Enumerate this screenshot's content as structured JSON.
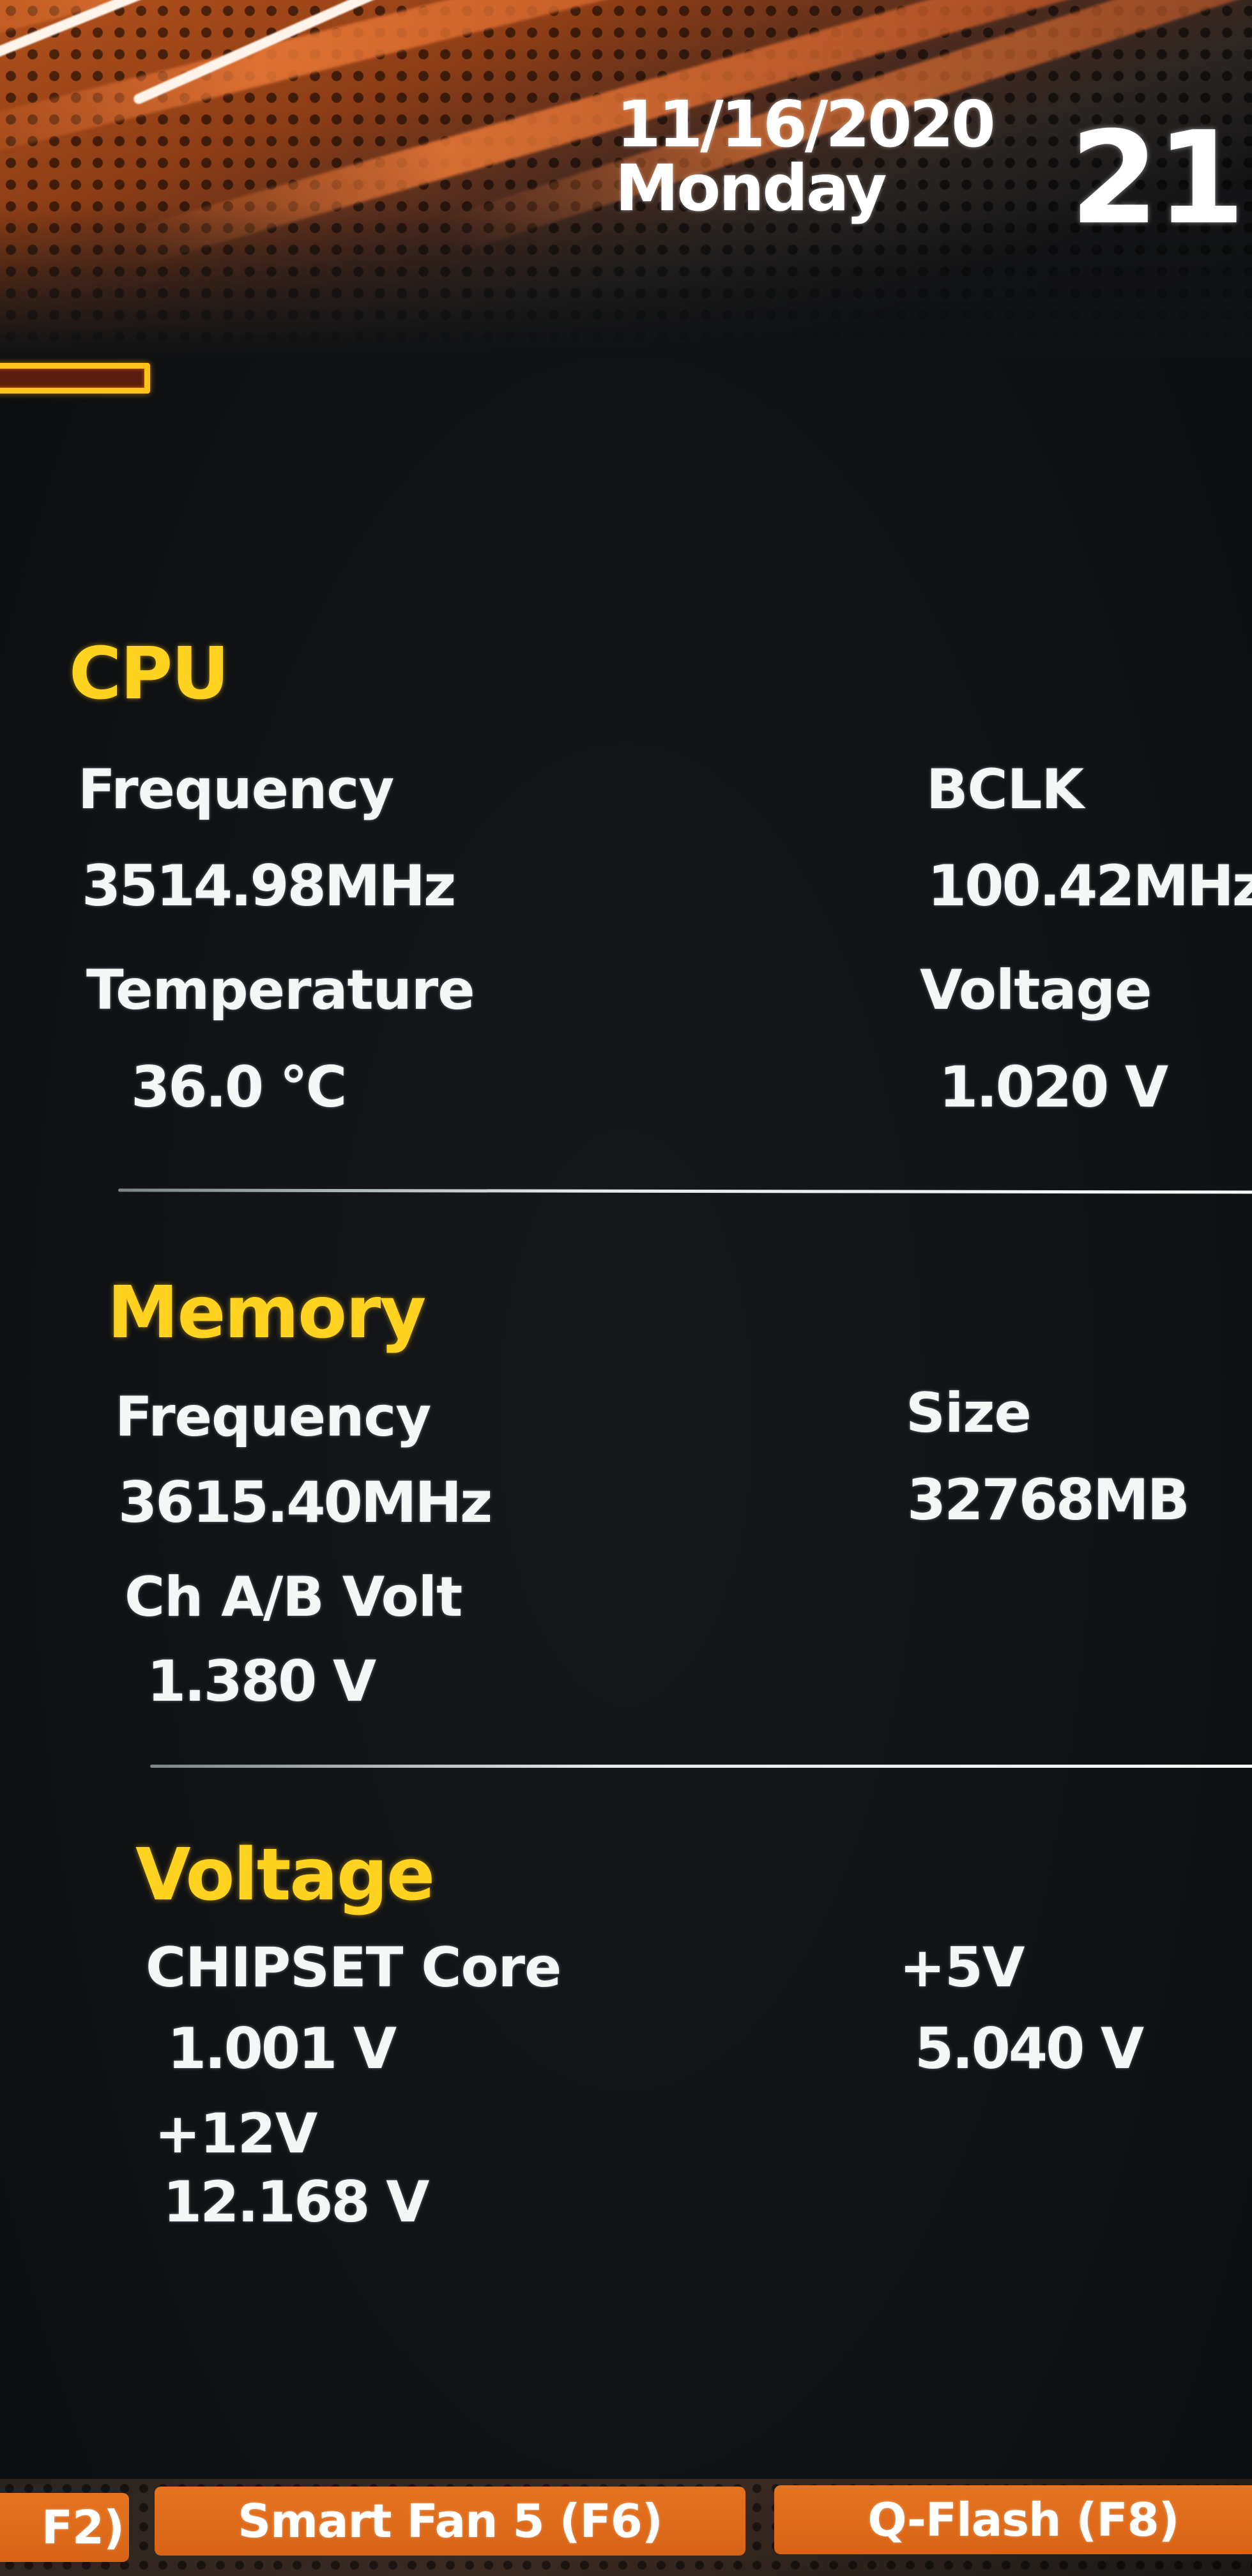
{
  "header": {
    "date": "11/16/2020",
    "day": "Monday",
    "time_partial": "21"
  },
  "sections": {
    "cpu": {
      "title": "CPU",
      "frequency_label": "Frequency",
      "frequency_value": "3514.98MHz",
      "bclk_label": "BCLK",
      "bclk_value": "100.42MHz",
      "temperature_label": "Temperature",
      "temperature_value": "36.0 °C",
      "voltage_label": "Voltage",
      "voltage_value": "1.020 V"
    },
    "memory": {
      "title": "Memory",
      "frequency_label": "Frequency",
      "frequency_value": "3615.40MHz",
      "size_label": "Size",
      "size_value": "32768MB",
      "ch_volt_label": "Ch A/B Volt",
      "ch_volt_value": "1.380 V"
    },
    "voltage": {
      "title": "Voltage",
      "chipset_label": "CHIPSET Core",
      "chipset_value": "1.001 V",
      "plus5_label": "+5V",
      "plus5_value": "5.040 V",
      "plus12_label": "+12V",
      "plus12_value": "12.168 V"
    }
  },
  "footer": {
    "buttons": [
      {
        "label": "F2)"
      },
      {
        "label": "Smart Fan 5 (F6)"
      },
      {
        "label": "Q-Flash (F8)"
      }
    ]
  },
  "colors": {
    "section_title": "#ffd31f",
    "accent_orange": "#e0691a",
    "text": "#f5f7f7",
    "background": "#101214"
  }
}
